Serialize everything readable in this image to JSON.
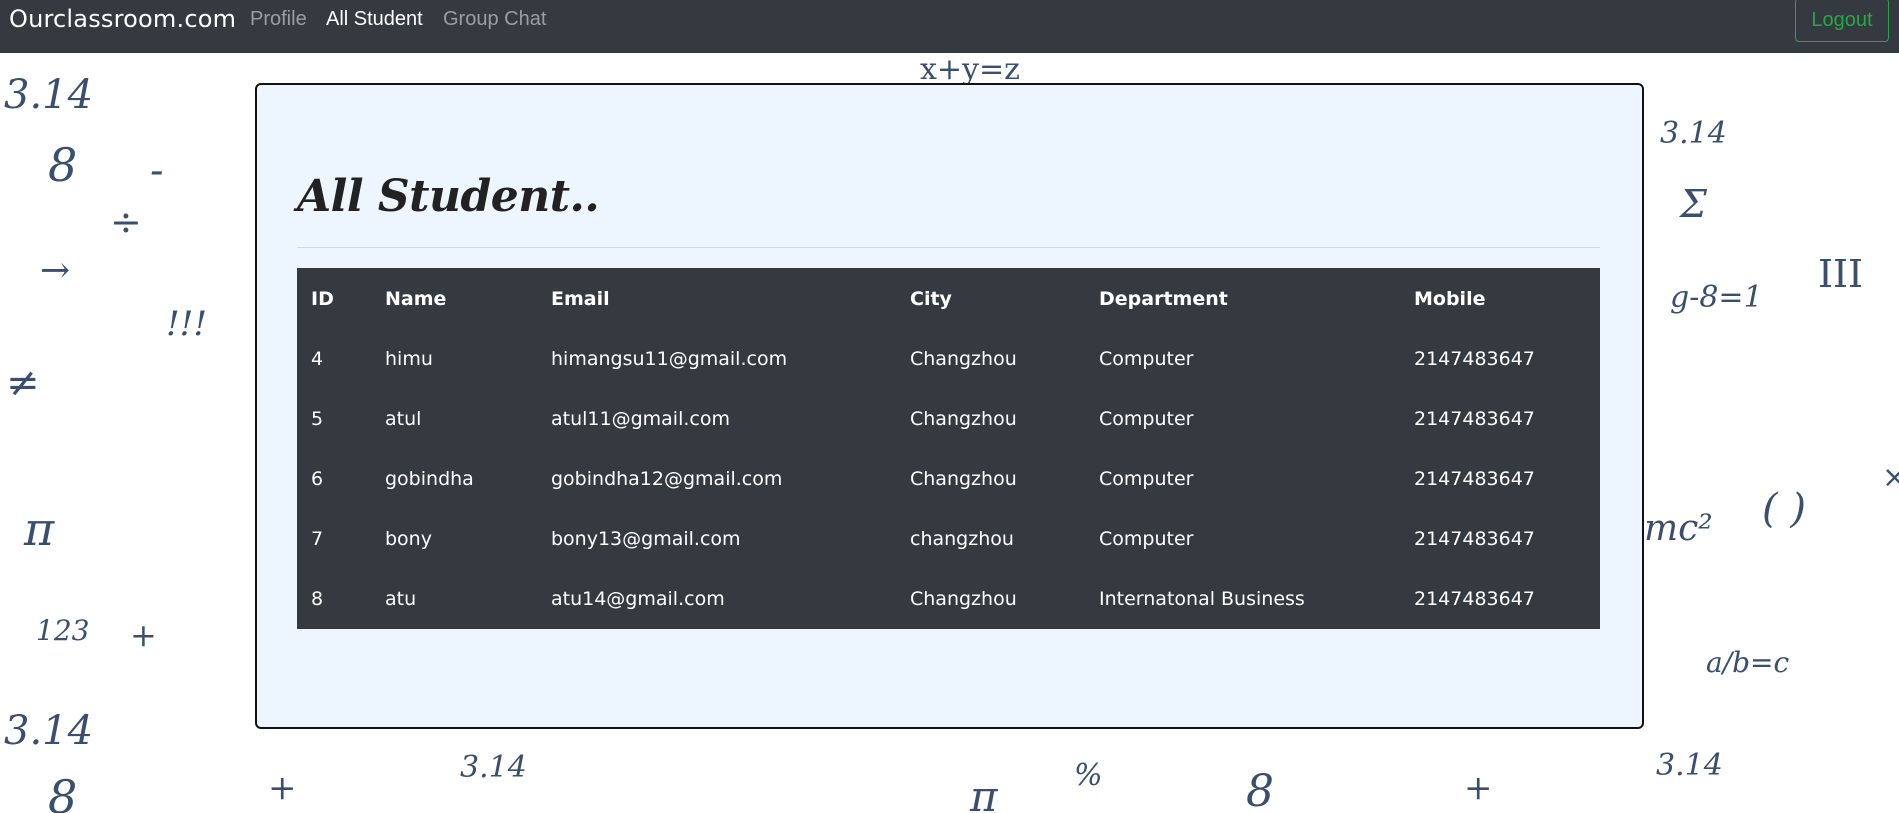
{
  "nav": {
    "brand": "Ourclassroom.com",
    "links": [
      {
        "label": "Profile",
        "active": false
      },
      {
        "label": "All Student",
        "active": true
      },
      {
        "label": "Group Chat",
        "active": false
      }
    ],
    "logout_label": "Logout"
  },
  "colors": {
    "navbar": "#343a40",
    "card_bg": "#edf5ff",
    "table_bg": "#343a40",
    "logout": "#28a745"
  },
  "main": {
    "title": "All Student..",
    "table": {
      "headers": [
        "ID",
        "Name",
        "Email",
        "City",
        "Department",
        "Mobile"
      ],
      "rows": [
        [
          "4",
          "himu",
          "himangsu11@gmail.com",
          "Changzhou",
          "Computer",
          "2147483647"
        ],
        [
          "5",
          "atul",
          "atul11@gmail.com",
          "Changzhou",
          "Computer",
          "2147483647"
        ],
        [
          "6",
          "gobindha",
          "gobindha12@gmail.com",
          "Changzhou",
          "Computer",
          "2147483647"
        ],
        [
          "7",
          "bony",
          "bony13@gmail.com",
          "changzhou",
          "Computer",
          "2147483647"
        ],
        [
          "8",
          "atu",
          "atu14@gmail.com",
          "Changzhou",
          "Internatonal Business",
          "2147483647"
        ]
      ]
    }
  },
  "background": {
    "doodles": [
      "3.14",
      "8",
      "÷",
      "!!!",
      "π",
      "123",
      "+",
      "x+y=z",
      "Σ",
      "g-8=1",
      "III",
      "mc²",
      "( )",
      "a/b=c",
      "%",
      "-",
      "≠",
      "→",
      "×"
    ]
  }
}
